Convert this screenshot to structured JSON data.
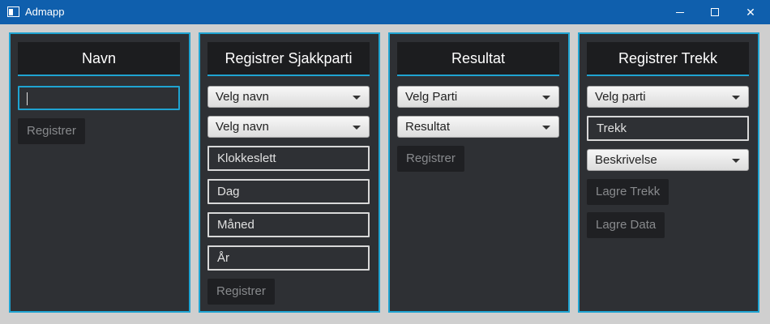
{
  "window": {
    "title": "Admapp",
    "controls": {
      "minimize": "minimize-icon",
      "maximize": "maximize-icon",
      "close": "✕"
    }
  },
  "panels": {
    "navn": {
      "header": "Navn",
      "name_input": {
        "value": ""
      },
      "register_button": "Registrer"
    },
    "sjakkparti": {
      "header": "Registrer Sjakkparti",
      "player1": "Velg navn",
      "player2": "Velg navn",
      "time_placeholder": "Klokkeslett",
      "day_placeholder": "Dag",
      "month_placeholder": "Måned",
      "year_placeholder": "År",
      "register_button": "Registrer"
    },
    "resultat": {
      "header": "Resultat",
      "game_select": "Velg Parti",
      "result_select": "Resultat",
      "register_button": "Registrer"
    },
    "trekk": {
      "header": "Registrer Trekk",
      "game_select": "Velg parti",
      "move_placeholder": "Trekk",
      "description_select": "Beskrivelse",
      "save_move_button": "Lagre Trekk",
      "save_data_button": "Lagre Data"
    }
  },
  "colors": {
    "titlebar": "#0f5fad",
    "panel_bg": "#2e3034",
    "accent": "#1fa3d1",
    "header_bg": "#1c1d1f",
    "button_bg": "#1f2023"
  }
}
